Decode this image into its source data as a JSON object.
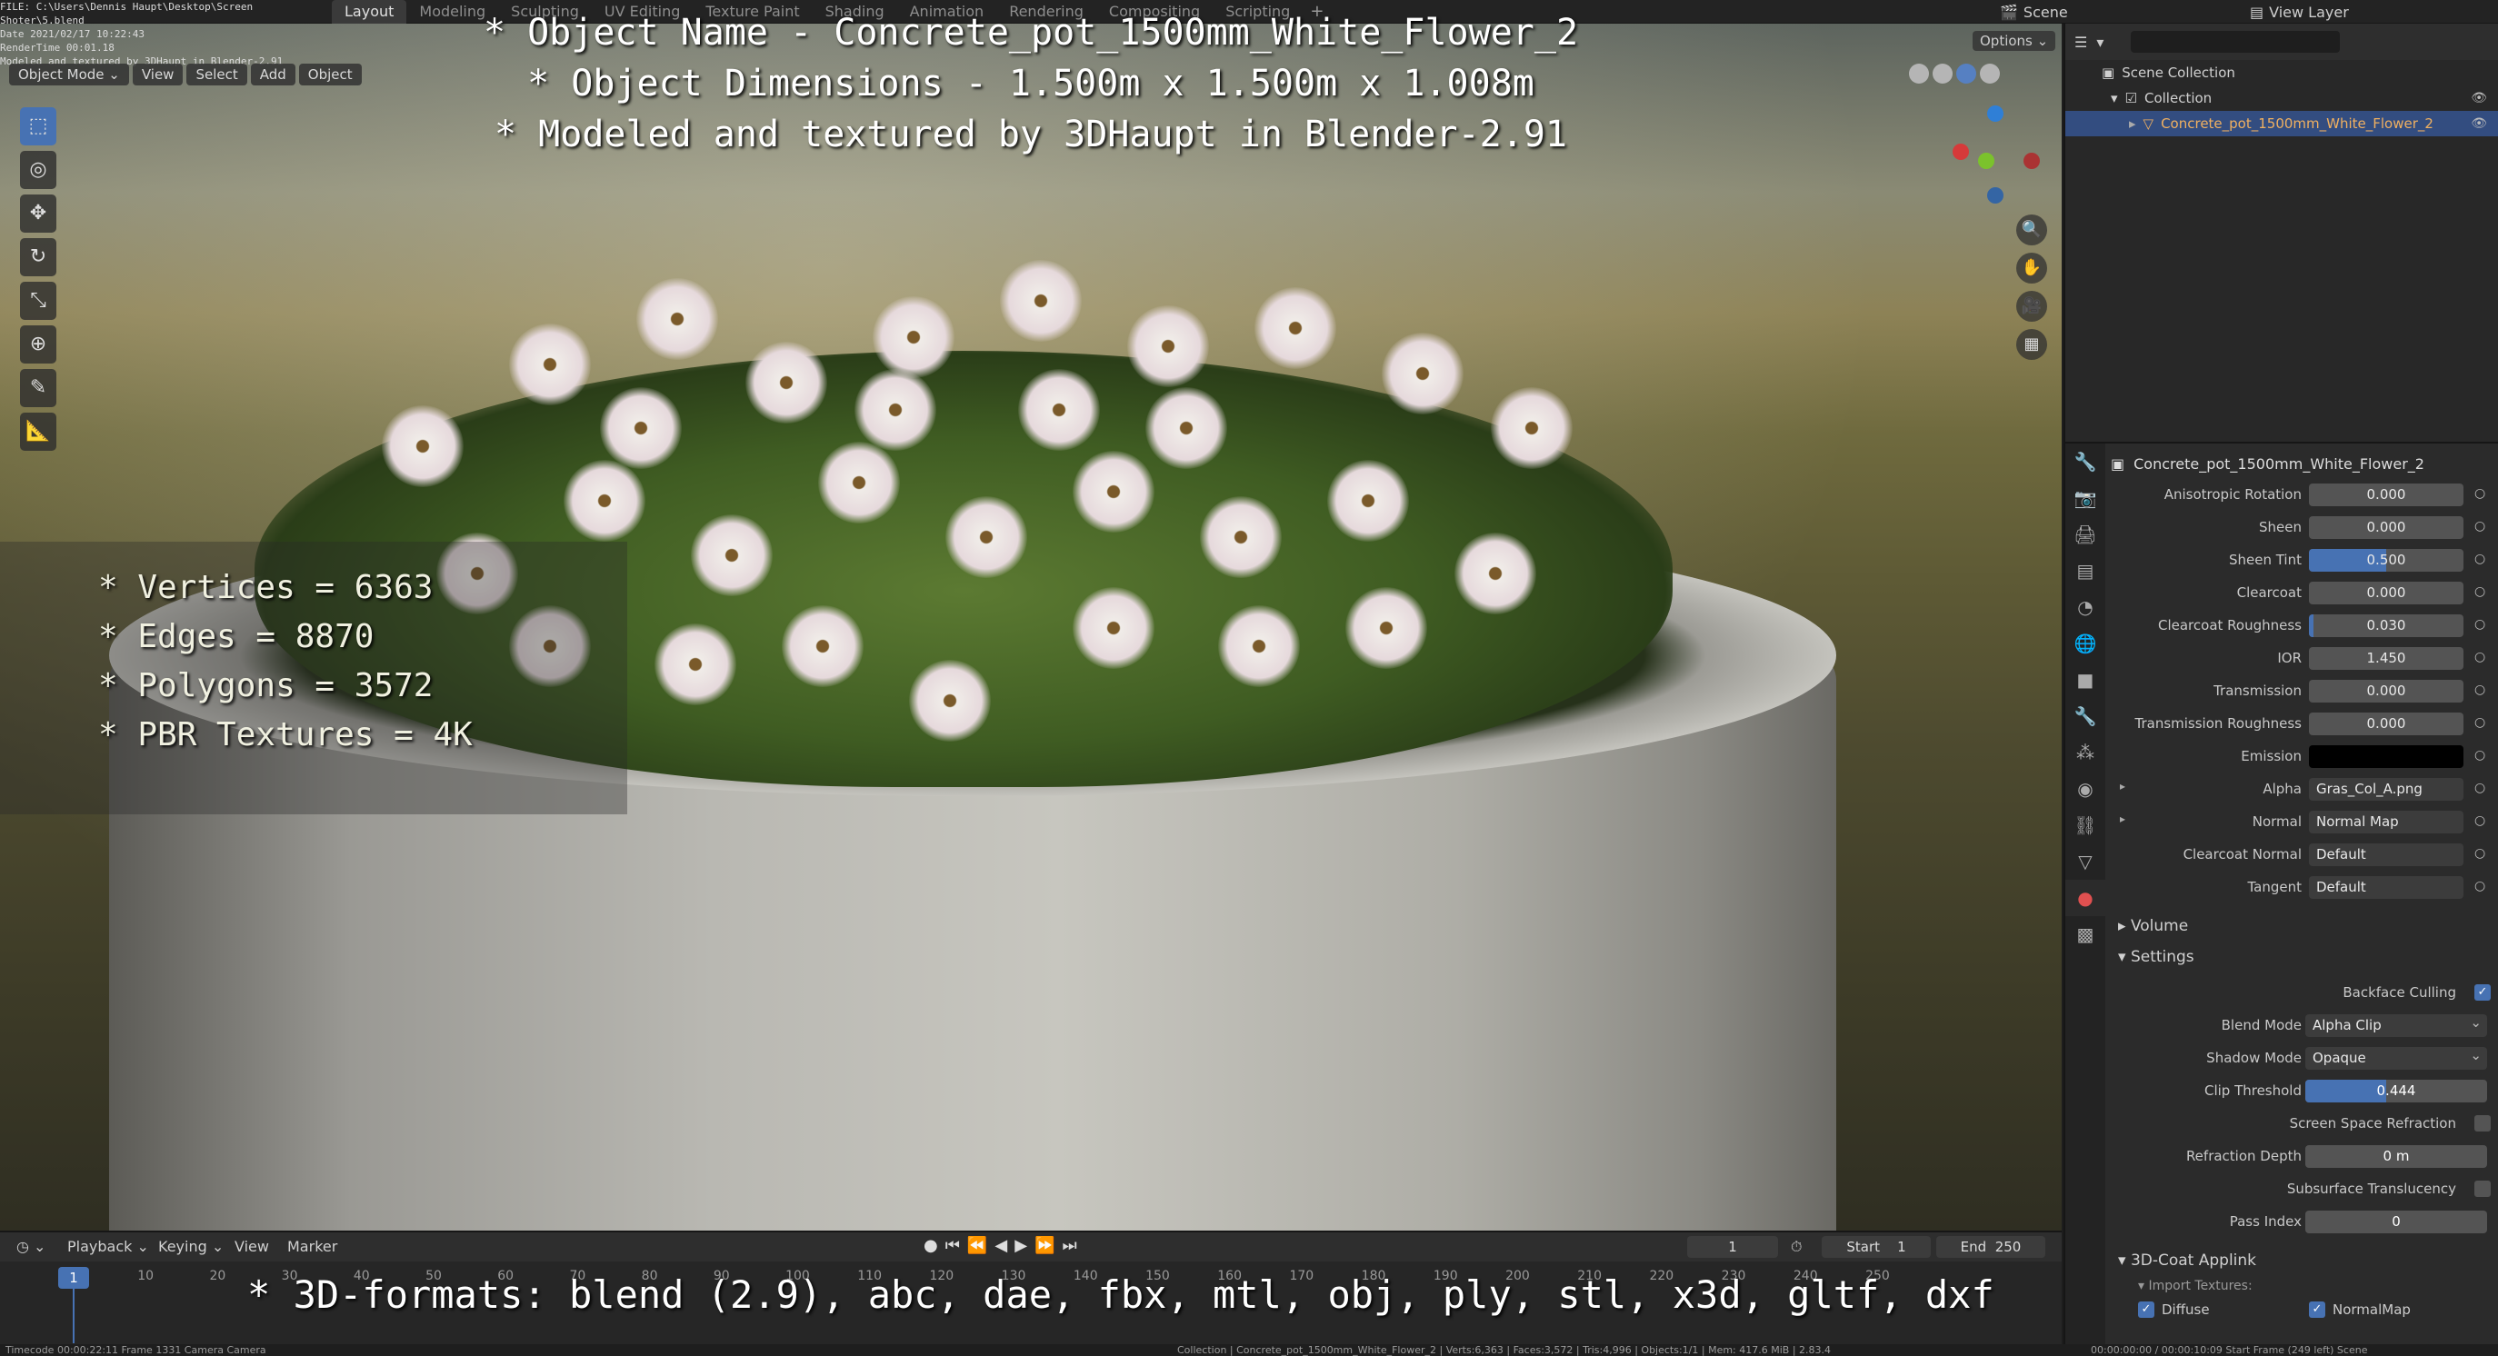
{
  "file_info": {
    "line1": "FILE: C:\\Users\\Dennis Haupt\\Desktop\\Screen Shoter\\5.blend",
    "line2": "Date 2021/02/17 10:22:43",
    "line3": "RenderTime 00:01.18",
    "line4": "Modeled and textured by 3DHaupt in Blender-2.91"
  },
  "workspaces": [
    "Layout",
    "Modeling",
    "Sculpting",
    "UV Editing",
    "Texture Paint",
    "Shading",
    "Animation",
    "Rendering",
    "Compositing",
    "Scripting"
  ],
  "workspace_add": "+",
  "scene_label": "Scene",
  "view_layer_label": "View Layer",
  "overlay": {
    "line1": "* Object Name - Concrete_pot_1500mm_White_Flower_2",
    "line2": "* Object Dimensions -  1.500m x 1.500m x 1.008m",
    "line3": "* Modeled and textured by 3DHaupt in Blender-2.91",
    "stats": [
      "* Vertices = 6363",
      "* Edges = 8870",
      "* Polygons = 3572",
      "* PBR Textures = 4K"
    ],
    "formats": "* 3D-formats: blend (2.9), abc, dae, fbx, mtl, obj, ply, stl, x3d, gltf, dxf"
  },
  "viewport_header": {
    "mode": "Object Mode",
    "menus": [
      "View",
      "Select",
      "Add",
      "Object"
    ],
    "options": "Options"
  },
  "outliner": {
    "root": "Scene Collection",
    "collection": "Collection",
    "object": "Concrete_pot_1500mm_White_Flower_2"
  },
  "properties": {
    "object_name": "Concrete_pot_1500mm_White_Flower_2",
    "rows": [
      {
        "label": "Anisotropic Rotation",
        "value": "0.000",
        "fill": 0
      },
      {
        "label": "Sheen",
        "value": "0.000",
        "fill": 0
      },
      {
        "label": "Sheen Tint",
        "value": "0.500",
        "fill": 0.5
      },
      {
        "label": "Clearcoat",
        "value": "0.000",
        "fill": 0
      },
      {
        "label": "Clearcoat Roughness",
        "value": "0.030",
        "fill": 0.03
      },
      {
        "label": "IOR",
        "value": "1.450",
        "fill": 0
      },
      {
        "label": "Transmission",
        "value": "0.000",
        "fill": 0
      },
      {
        "label": "Transmission Roughness",
        "value": "0.000",
        "fill": 0
      }
    ],
    "emission_label": "Emission",
    "emission_color": "#000000",
    "alpha_label": "Alpha",
    "alpha_value": "Gras_Col_A.png",
    "normal_label": "Normal",
    "normal_value": "Normal Map",
    "clearcoat_normal_label": "Clearcoat Normal",
    "clearcoat_normal_value": "Default",
    "tangent_label": "Tangent",
    "tangent_value": "Default",
    "volume_section": "Volume",
    "settings_section": "Settings",
    "backface_culling": "Backface Culling",
    "blend_mode_label": "Blend Mode",
    "blend_mode_value": "Alpha Clip",
    "shadow_mode_label": "Shadow Mode",
    "shadow_mode_value": "Opaque",
    "clip_threshold_label": "Clip Threshold",
    "clip_threshold_value": "0.444",
    "clip_threshold_fill": 0.444,
    "ssr_label": "Screen Space Refraction",
    "refraction_depth_label": "Refraction Depth",
    "refraction_depth_value": "0 m",
    "subsurface_label": "Subsurface Translucency",
    "pass_index_label": "Pass Index",
    "pass_index_value": "0",
    "coat_section": "3D-Coat Applink",
    "import_textures": "Import Textures:",
    "diffuse": "Diffuse",
    "normalmap": "NormalMap"
  },
  "timeline": {
    "menus": [
      "Playback",
      "Keying",
      "View",
      "Marker"
    ],
    "current_frame": "1",
    "start_label": "Start",
    "start_value": "1",
    "end_label": "End",
    "end_value": "250",
    "ticks": [
      "1",
      "10",
      "20",
      "30",
      "40",
      "50",
      "60",
      "70",
      "80",
      "90",
      "100",
      "110",
      "120",
      "130",
      "140",
      "150",
      "160",
      "170",
      "180",
      "190",
      "200",
      "210",
      "220",
      "230",
      "240",
      "250"
    ]
  },
  "statusbar": {
    "left": "Timecode 00:00:22:11   Frame 1331   Camera Camera",
    "center": "Collection | Concrete_pot_1500mm_White_Flower_2 | Verts:6,363 | Faces:3,572 | Tris:4,996 | Objects:1/1 | Mem: 417.6 MiB | 2.83.4",
    "right": "00:00:00:00 / 00:00:10:09   Start Frame (249 left)   Scene"
  },
  "colors": {
    "accent": "#4772b3",
    "selected_object": "#f0b060",
    "emission": "#000000"
  }
}
